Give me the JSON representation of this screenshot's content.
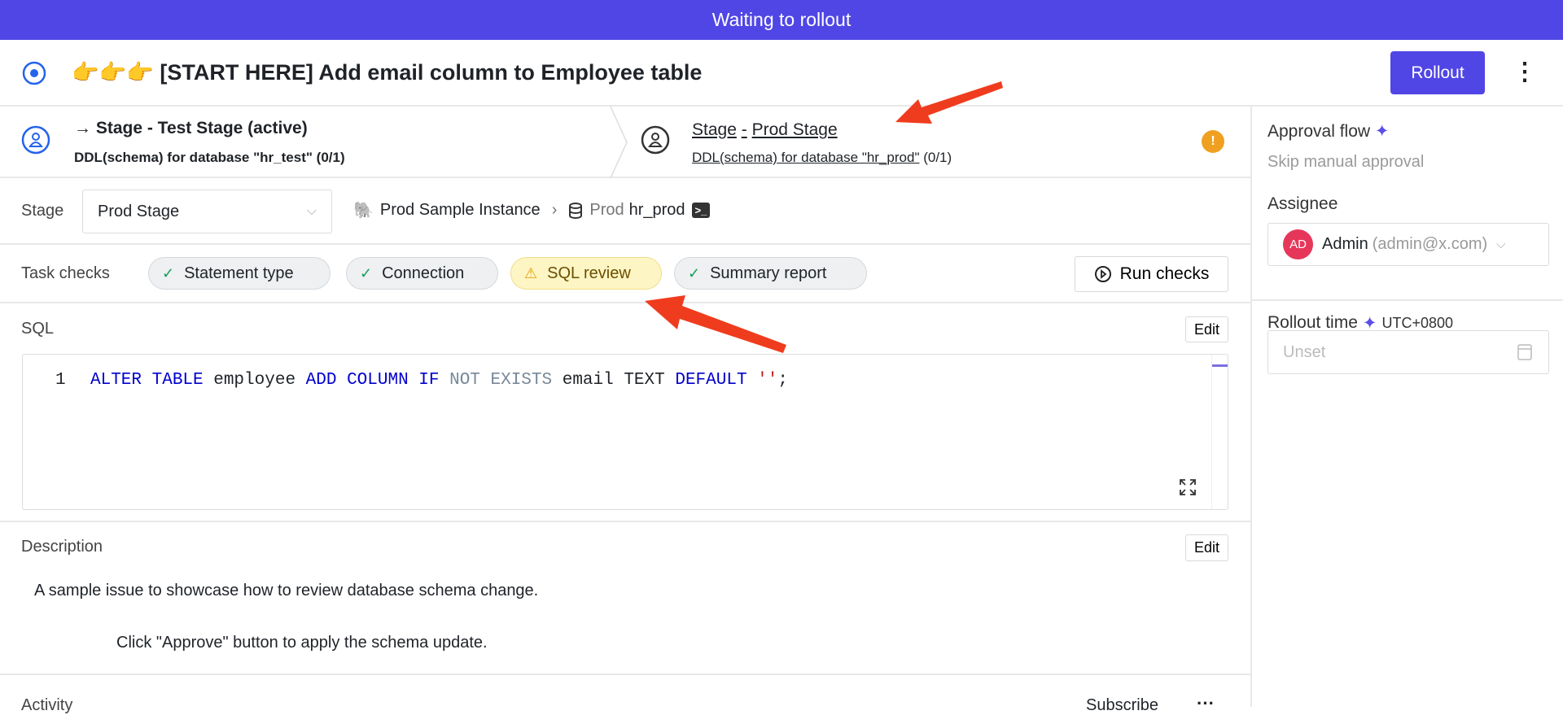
{
  "banner": {
    "text": "Waiting to rollout"
  },
  "header": {
    "title": "👉👉👉 [START HERE] Add email column to Employee table",
    "rollout_label": "Rollout",
    "more_icon": "kebab-icon"
  },
  "stages": [
    {
      "title": "→ Stage - Test Stage (active)",
      "task": "DDL(schema) for database \"hr_test\"",
      "count": "(0/1)",
      "icon": "user-circle-icon"
    },
    {
      "title_prefix": "Stage",
      "sep": "-",
      "title_name": "Prod Stage",
      "task": "DDL(schema) for database \"hr_prod\"",
      "count": "(0/1)",
      "icon": "user-circle-icon",
      "status": "warning"
    }
  ],
  "stage_row": {
    "label": "Stage",
    "selected": "Prod Stage",
    "instance": "Prod Sample Instance",
    "env": "Prod",
    "database": "hr_prod"
  },
  "task_checks": {
    "label": "Task checks",
    "checks": [
      {
        "label": "Statement type",
        "status": "success"
      },
      {
        "label": "Connection",
        "status": "success"
      },
      {
        "label": "SQL review",
        "status": "warning"
      },
      {
        "label": "Summary report",
        "status": "success"
      }
    ],
    "run_label": "Run checks"
  },
  "sql": {
    "label": "SQL",
    "edit_label": "Edit",
    "line_number": "1",
    "tokens": [
      {
        "t": "ALTER TABLE",
        "c": "kw"
      },
      {
        "t": " employee ",
        "c": ""
      },
      {
        "t": "ADD COLUMN IF",
        "c": "kw"
      },
      {
        "t": " NOT EXISTS",
        "c": "gr"
      },
      {
        "t": " email TEXT ",
        "c": ""
      },
      {
        "t": "DEFAULT",
        "c": "kw"
      },
      {
        "t": " ''",
        "c": "str"
      },
      {
        "t": ";",
        "c": ""
      }
    ]
  },
  "description": {
    "label": "Description",
    "edit_label": "Edit",
    "line1": "A sample issue to showcase how to review database schema change.",
    "line2": "Click \"Approve\" button to apply the schema update."
  },
  "activity": {
    "label": "Activity",
    "subscribe_label": "Subscribe",
    "more": "···"
  },
  "sidebar": {
    "approval_label": "Approval flow",
    "approval_value": "Skip manual approval",
    "assignee_label": "Assignee",
    "assignee_initials": "AD",
    "assignee_name": "Admin",
    "assignee_email": "(admin@x.com)",
    "rollout_time_label": "Rollout time",
    "timezone": "UTC+0800",
    "rollout_time_placeholder": "Unset"
  },
  "colors": {
    "accent": "#5046e5",
    "warning": "#f0a020",
    "success": "#18a058",
    "annotation_arrow": "#f03c1e",
    "avatar": "#e6375a"
  }
}
